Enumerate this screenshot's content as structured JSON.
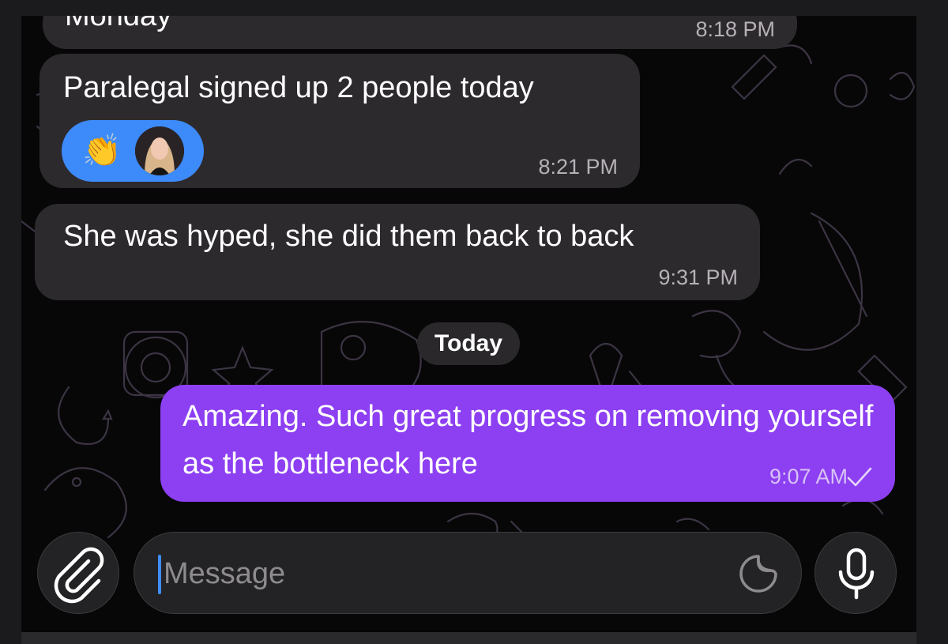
{
  "messages": [
    {
      "text": "Monday",
      "time": "8:18 PM"
    },
    {
      "text": "Paralegal signed up 2 people today",
      "time": "8:21 PM",
      "reaction": {
        "emoji": "👏",
        "avatar": "avatar"
      }
    },
    {
      "text": "She was hyped, she did them back to back",
      "time": "9:31 PM"
    }
  ],
  "date_divider": "Today",
  "outgoing": {
    "text": "Amazing. Such great progress on removing yourself as the bottleneck here",
    "time": "9:07 AM",
    "status_icon": "checkmark-icon"
  },
  "composer": {
    "placeholder": "Message",
    "icons": [
      "paperclip-icon",
      "sticker-icon",
      "microphone-icon"
    ]
  },
  "colors": {
    "incoming_bubble": "#2d2a2e",
    "outgoing_bubble": "#8d3ff2",
    "reaction_pill": "#3d8bfa",
    "caret": "#3e8df5"
  }
}
